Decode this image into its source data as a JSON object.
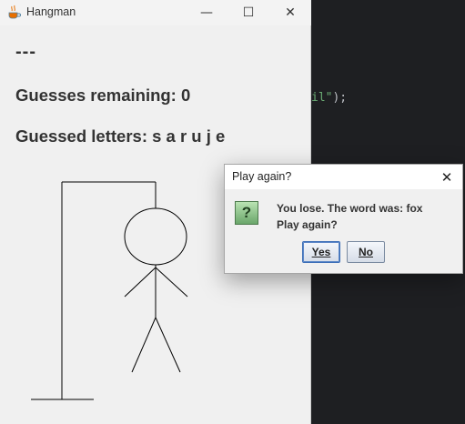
{
  "editor": {
    "code_string": "il\"",
    "code_tail": ");"
  },
  "window": {
    "title": "Hangman",
    "icon": "java-coffee-cup-icon",
    "controls": {
      "minimize": "—",
      "maximize": "☐",
      "close": "✕"
    }
  },
  "game": {
    "word_display": "---",
    "guesses_remaining": "Guesses remaining: 0",
    "guessed_letters": "Guessed letters: s a r u j e"
  },
  "dialog": {
    "title": "Play again?",
    "close": "✕",
    "icon": "question-icon",
    "icon_glyph": "?",
    "message_line1": "You lose. The word was: fox",
    "message_line2": "Play again?",
    "yes_label": "Yes",
    "no_label": "No"
  },
  "colors": {
    "window_bg": "#f0f0f0",
    "editor_bg": "#1e1f22",
    "code_string": "#6aab73",
    "icon_green": "#6aa66a"
  }
}
